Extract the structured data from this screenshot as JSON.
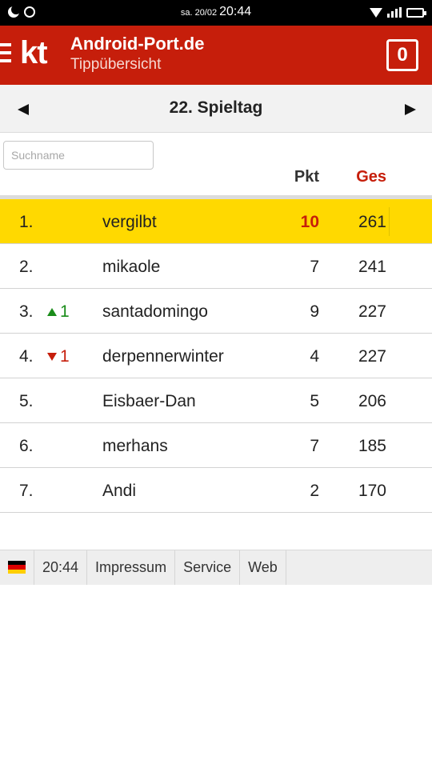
{
  "status_bar": {
    "date": "sa. 20/02",
    "time": "20:44"
  },
  "header": {
    "logo": "kt",
    "title": "Android-Port.de",
    "subtitle": "Tippübersicht",
    "badge_count": "0"
  },
  "round_nav": {
    "title": "22. Spieltag"
  },
  "search": {
    "placeholder": "Suchname",
    "value": ""
  },
  "columns": {
    "points": "Pkt",
    "total": "Ges"
  },
  "rows": [
    {
      "rank": "1.",
      "trend": "",
      "trend_dir": "",
      "name": "vergilbt",
      "pkt": "10",
      "ges": "261",
      "highlight": true
    },
    {
      "rank": "2.",
      "trend": "",
      "trend_dir": "",
      "name": "mikaole",
      "pkt": "7",
      "ges": "241",
      "highlight": false
    },
    {
      "rank": "3.",
      "trend": "1",
      "trend_dir": "up",
      "name": "santadomingo",
      "pkt": "9",
      "ges": "227",
      "highlight": false
    },
    {
      "rank": "4.",
      "trend": "1",
      "trend_dir": "down",
      "name": "derpennerwinter",
      "pkt": "4",
      "ges": "227",
      "highlight": false
    },
    {
      "rank": "5.",
      "trend": "",
      "trend_dir": "",
      "name": "Eisbaer-Dan",
      "pkt": "5",
      "ges": "206",
      "highlight": false
    },
    {
      "rank": "6.",
      "trend": "",
      "trend_dir": "",
      "name": "merhans",
      "pkt": "7",
      "ges": "185",
      "highlight": false
    },
    {
      "rank": "7.",
      "trend": "",
      "trend_dir": "",
      "name": "Andi",
      "pkt": "2",
      "ges": "170",
      "highlight": false
    }
  ],
  "footer": {
    "flag_icon": "germany-flag-icon",
    "time": "20:44",
    "links": [
      "Impressum",
      "Service",
      "Web"
    ]
  },
  "colors": {
    "brand_red": "#c61e0b",
    "highlight_yellow": "#ffd900",
    "trend_up": "#1a8c1a",
    "trend_down": "#c61e0b"
  }
}
